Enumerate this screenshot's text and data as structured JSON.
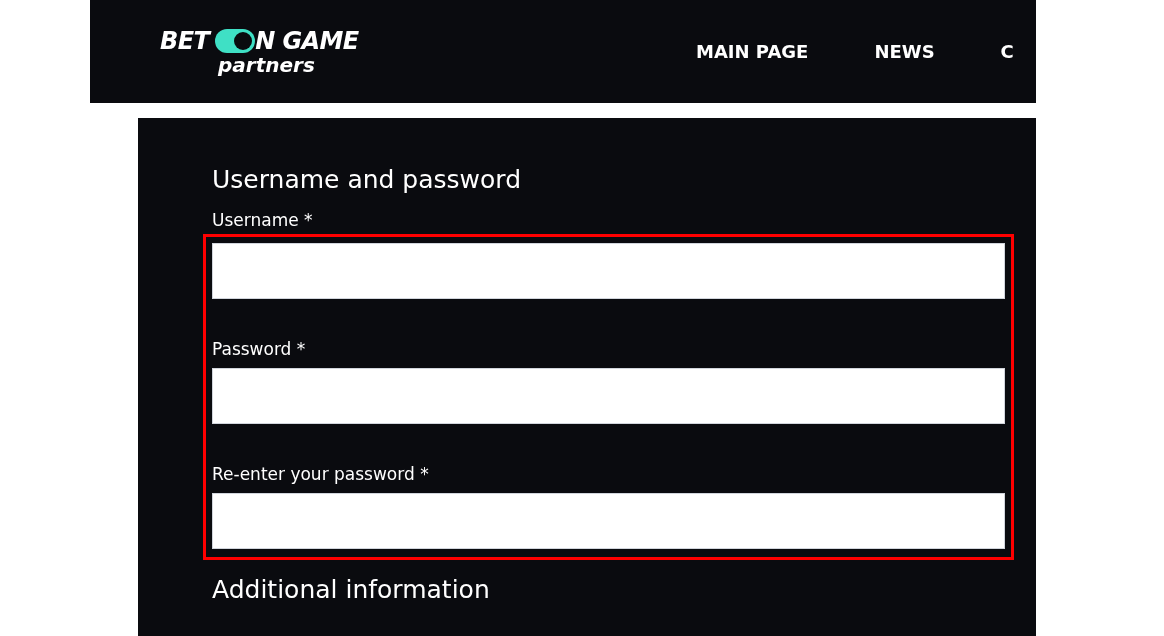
{
  "header": {
    "logo": {
      "word_1": "BET",
      "word_2": "N GAME",
      "tagline": "partners"
    },
    "nav": [
      "MAIN PAGE",
      "NEWS",
      "C"
    ]
  },
  "form": {
    "sections": [
      {
        "title": "Username and password",
        "highlighted": true,
        "fields": [
          {
            "label": "Username *"
          },
          {
            "label": "Password *"
          },
          {
            "label": "Re-enter your password *"
          }
        ]
      },
      {
        "title": "Additional information"
      }
    ]
  }
}
